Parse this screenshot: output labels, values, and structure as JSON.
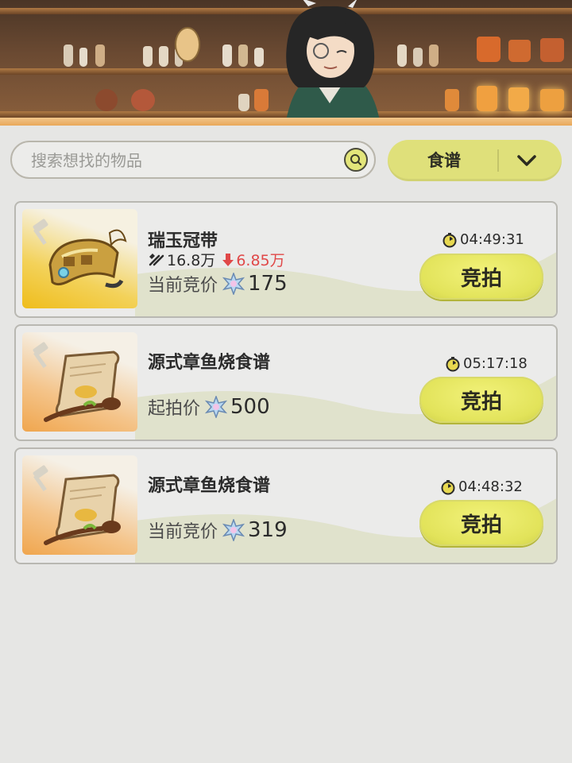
{
  "search": {
    "placeholder": "搜索想找的物品"
  },
  "filter": {
    "selected": "食谱"
  },
  "items": [
    {
      "name": "瑞玉冠带",
      "volume": "16.8万",
      "change": "6.85万",
      "price_label": "当前竞价",
      "price": "175",
      "time_left": "04:49:31",
      "bid_label": "竞拍",
      "thumb_icon": "jade-crown-icon"
    },
    {
      "name": "源式章鱼烧食谱",
      "price_label": "起拍价",
      "price": "500",
      "time_left": "05:17:18",
      "bid_label": "竞拍",
      "thumb_icon": "recipe-scroll-icon"
    },
    {
      "name": "源式章鱼烧食谱",
      "price_label": "当前竞价",
      "price": "319",
      "time_left": "04:48:32",
      "bid_label": "竞拍",
      "thumb_icon": "recipe-scroll-icon"
    }
  ],
  "colors": {
    "accent": "#e2e35a",
    "down": "#e04848",
    "background": "#e6e6e4"
  }
}
